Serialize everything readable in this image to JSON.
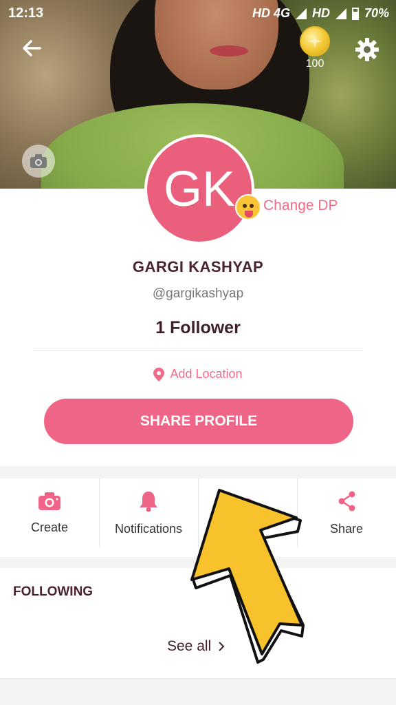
{
  "status_bar": {
    "time": "12:13",
    "network": "HD 4G",
    "network2": "HD",
    "battery": "70%"
  },
  "header": {
    "coin_count": "100"
  },
  "profile": {
    "avatar_initials": "GK",
    "change_dp_label": "Change DP",
    "name": "GARGI KASHYAP",
    "handle": "@gargikashyap",
    "followers": "1 Follower",
    "location_label": "Add Location",
    "share_button_label": "SHARE PROFILE"
  },
  "actions": {
    "items": [
      {
        "label": "Create",
        "icon": "camera-icon"
      },
      {
        "label": "Notifications",
        "icon": "bell-icon"
      },
      {
        "label": "",
        "icon": "profile-icon"
      },
      {
        "label": "Share",
        "icon": "share-icon"
      }
    ]
  },
  "following": {
    "title": "FOLLOWING",
    "see_all_label": "See all"
  },
  "colors": {
    "accent": "#ef6587",
    "avatar_bg": "#ea5f7c",
    "name_text": "#4a2331",
    "overlay_arrow": "#f7c22b"
  }
}
